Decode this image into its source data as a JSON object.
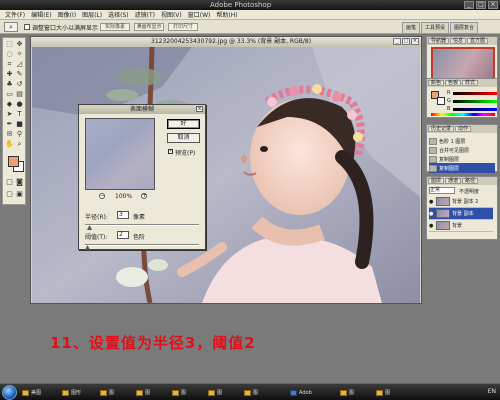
{
  "titlebar": {
    "title": "Adobe Photoshop"
  },
  "menu": [
    "文件(F)",
    "编辑(E)",
    "图像(I)",
    "图层(L)",
    "选择(S)",
    "滤镜(T)",
    "视图(V)",
    "窗口(W)",
    "帮助(H)"
  ],
  "options": {
    "checkbox_label": "调整窗口大小以满屏显示",
    "buttons": [
      "实际像素",
      "满画布显示",
      "打印尺寸"
    ]
  },
  "palette_well_tabs": [
    "画笔",
    "工具预设",
    "图层复合"
  ],
  "document": {
    "title": "31232004253430792.jpg @ 33.3% (背景 副本, RGB/8)"
  },
  "dialog": {
    "title": "表面模糊",
    "ok": "好",
    "cancel": "取消",
    "preview_label": "预览(P)",
    "zoom": "100%",
    "radius_label": "半径(R):",
    "radius_value": "3",
    "radius_unit": "像素",
    "threshold_label": "阈值(T):",
    "threshold_value": "2",
    "threshold_unit": "色阶"
  },
  "navigator": {
    "tabs": [
      "导航器",
      "信息",
      "直方图"
    ]
  },
  "color": {
    "tabs": [
      "颜色",
      "色板",
      "样式"
    ],
    "labels": [
      "R",
      "G",
      "B"
    ],
    "fg": "#f0a070"
  },
  "history": {
    "tabs": [
      "历史记录",
      "动作"
    ],
    "items": [
      "色阶 1 图层",
      "合并可见图层",
      "复制图层",
      "复制图层"
    ]
  },
  "layers": {
    "tabs": [
      "图层",
      "通道",
      "路径"
    ],
    "mode": "正常",
    "opacity": "不透明度",
    "items": [
      {
        "name": "背景 副本 2",
        "selected": false
      },
      {
        "name": "背景 副本",
        "selected": true
      },
      {
        "name": "背景",
        "selected": false
      }
    ]
  },
  "caption": "11、设置值为半径3，阈值2",
  "taskbar": {
    "items": [
      "美图",
      "图形",
      "图",
      "图",
      "图",
      "图",
      "图",
      "Adob",
      "图",
      "图"
    ],
    "tray": "EN"
  }
}
